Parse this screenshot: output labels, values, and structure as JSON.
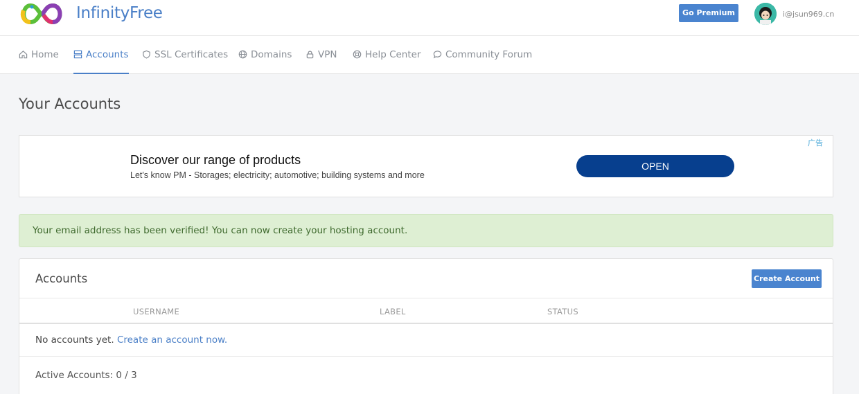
{
  "header": {
    "brand": "InfinityFree",
    "premium_label": "Go Premium",
    "user_email": "i@jsun969.cn"
  },
  "nav": {
    "items": [
      {
        "label": "Home",
        "icon": "home-icon"
      },
      {
        "label": "Accounts",
        "icon": "server-icon",
        "active": true
      },
      {
        "label": "SSL Certificates",
        "icon": "shield-icon"
      },
      {
        "label": "Domains",
        "icon": "globe-icon"
      },
      {
        "label": "VPN",
        "icon": "lock-icon"
      },
      {
        "label": "Help Center",
        "icon": "lifebuoy-icon"
      },
      {
        "label": "Community Forum",
        "icon": "chat-icon"
      }
    ]
  },
  "page": {
    "title": "Your Accounts"
  },
  "ad": {
    "title": "Discover our range of products",
    "description": "Let's know PM - Storages; electricity; automotive; building systems and more",
    "button_label": "OPEN",
    "tag": "广告"
  },
  "alert": {
    "message": "Your email address has been verified! You can now create your hosting account."
  },
  "accounts": {
    "title": "Accounts",
    "create_button": "Create Account",
    "columns": [
      "USERNAME",
      "LABEL",
      "STATUS"
    ],
    "empty_text": "No accounts yet.",
    "empty_link": "Create an account now.",
    "active_label": "Active Accounts: 0 / 3"
  },
  "colors": {
    "accent": "#4a84cf",
    "alert_bg": "#deefd3",
    "ad_button": "#073f8e"
  }
}
